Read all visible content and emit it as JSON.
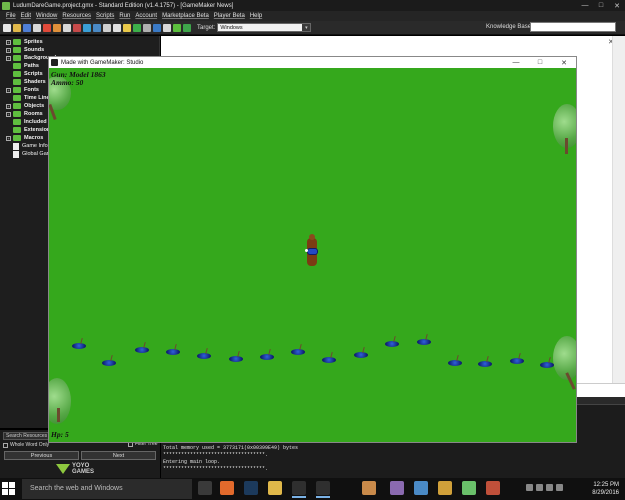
{
  "ide": {
    "title": "LudumDareGame.project.gmx  -  Standard Edition (v1.4.1757)   -  [GameMaker News]",
    "window_controls": [
      "—",
      "□",
      "✕"
    ],
    "menu": [
      "File",
      "Edit",
      "Window",
      "Resources",
      "Scripts",
      "Run",
      "Account",
      "Marketplace Beta",
      "Player Beta",
      "Help"
    ],
    "target_label": "Target:",
    "target_value": "Windows",
    "kb_label": "Knowledge Base:"
  },
  "resource_tree": [
    {
      "label": "Sprites",
      "kind": "folder"
    },
    {
      "label": "Sounds",
      "kind": "folder"
    },
    {
      "label": "Backgrounds",
      "kind": "folder"
    },
    {
      "label": "Paths",
      "kind": "folder"
    },
    {
      "label": "Scripts",
      "kind": "folder"
    },
    {
      "label": "Shaders",
      "kind": "folder"
    },
    {
      "label": "Fonts",
      "kind": "folder"
    },
    {
      "label": "Time Lines",
      "kind": "folder"
    },
    {
      "label": "Objects",
      "kind": "folder"
    },
    {
      "label": "Rooms",
      "kind": "folder"
    },
    {
      "label": "Included Files",
      "kind": "folder"
    },
    {
      "label": "Extensions",
      "kind": "folder"
    },
    {
      "label": "Macros",
      "kind": "folder"
    },
    {
      "label": "Game Information",
      "kind": "doc"
    },
    {
      "label": "Global Game Settings",
      "kind": "doc"
    }
  ],
  "search_panel": {
    "placeholder": "Search Resources",
    "whole_word": "Whole Word Only",
    "filter_tree": "Filter Tree",
    "previous": "Previous",
    "next": "Next",
    "logo_line1": "YOYO",
    "logo_line2": "GAMES"
  },
  "output": {
    "lines": [
      "Total memory used = 3773171(0x00399E49) bytes",
      "**********************************.",
      "Entering main loop.",
      "**********************************."
    ]
  },
  "game_window": {
    "title": "Made with GameMaker: Studio",
    "controls": [
      "—",
      "□",
      "✕"
    ],
    "hud_gun": "Gun: Model 1863",
    "hud_ammo": "Ammo: 50",
    "hud_hp": "Hp: 5"
  },
  "taskbar": {
    "search_text": "Search the web and Windows",
    "time": "12:25 PM",
    "date": "8/29/2016"
  }
}
